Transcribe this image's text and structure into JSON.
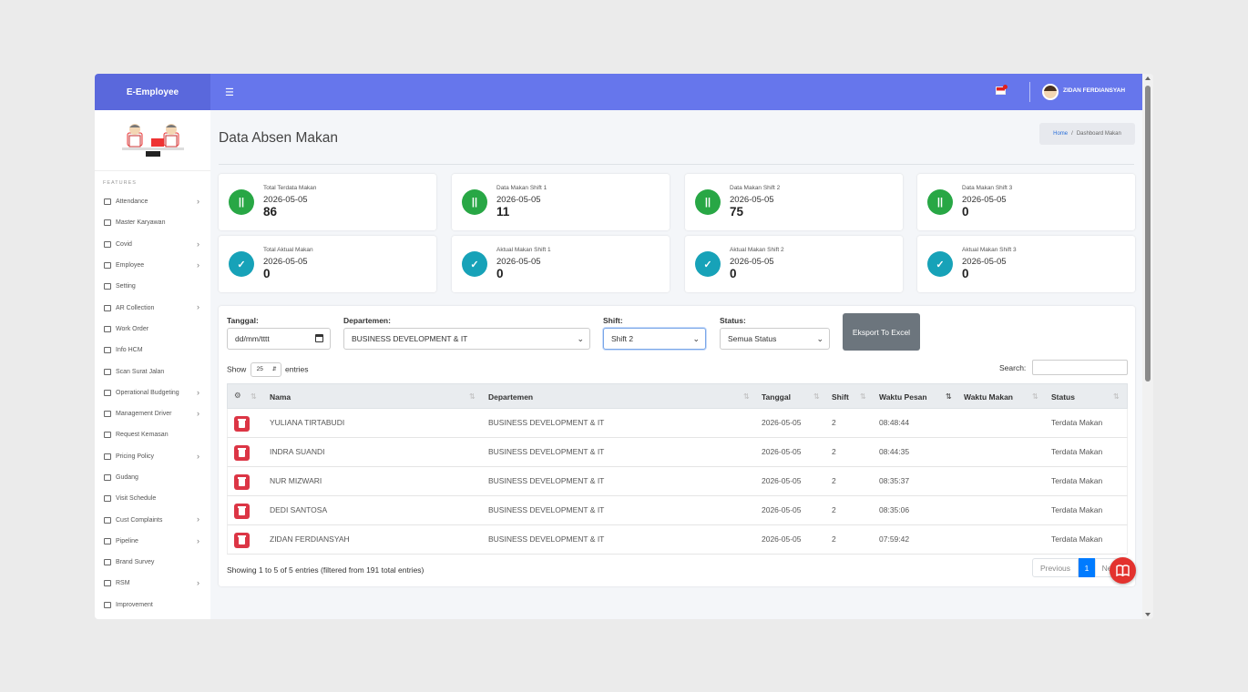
{
  "app": {
    "brand": "E-Employee",
    "user": "ZIDAN FERDIANSYAH"
  },
  "header": {
    "menu_icon": "menu-icon",
    "flag_icon": "flag-icon"
  },
  "sidebar": {
    "section": "FEATURES",
    "items": [
      {
        "label": "Attendance",
        "icon": "calendar-icon",
        "has_submenu": true
      },
      {
        "label": "Master Karyawan",
        "icon": "users-icon",
        "has_submenu": false
      },
      {
        "label": "Covid",
        "icon": "calendar-icon",
        "has_submenu": true
      },
      {
        "label": "Employee",
        "icon": "calendar-icon",
        "has_submenu": true
      },
      {
        "label": "Setting",
        "icon": "cogs-icon",
        "has_submenu": false
      },
      {
        "label": "AR Collection",
        "icon": "calendar-icon",
        "has_submenu": true
      },
      {
        "label": "Work Order",
        "icon": "clock-icon",
        "has_submenu": false
      },
      {
        "label": "Info HCM",
        "icon": "info-icon",
        "has_submenu": false
      },
      {
        "label": "Scan Surat Jalan",
        "icon": "folder-icon",
        "has_submenu": false
      },
      {
        "label": "Operational Budgeting",
        "icon": "calendar-icon",
        "has_submenu": true
      },
      {
        "label": "Management Driver",
        "icon": "calendar-icon",
        "has_submenu": true
      },
      {
        "label": "Request Kemasan",
        "icon": "send-icon",
        "has_submenu": false
      },
      {
        "label": "Pricing Policy",
        "icon": "calendar-icon",
        "has_submenu": true
      },
      {
        "label": "Gudang",
        "icon": "cogs-icon",
        "has_submenu": false
      },
      {
        "label": "Visit Schedule",
        "icon": "clock-icon",
        "has_submenu": false
      },
      {
        "label": "Cust Complaints",
        "icon": "folder-open-icon",
        "has_submenu": true
      },
      {
        "label": "Pipeline",
        "icon": "calendar-icon",
        "has_submenu": true
      },
      {
        "label": "Brand Survey",
        "icon": "comments-icon",
        "has_submenu": false
      },
      {
        "label": "RSM",
        "icon": "send-icon",
        "has_submenu": true
      },
      {
        "label": "Improvement",
        "icon": "cogs-icon",
        "has_submenu": false
      }
    ]
  },
  "page": {
    "title": "Data Absen Makan",
    "breadcrumb": {
      "home": "Home",
      "separator": "/",
      "current": "Dashboard Makan"
    }
  },
  "cards": [
    {
      "label": "Total Terdata Makan",
      "date": "2026-05-05",
      "value": "86",
      "icon": "utensils-icon",
      "color": "#28a745"
    },
    {
      "label": "Data Makan Shift 1",
      "date": "2026-05-05",
      "value": "11",
      "icon": "utensils-icon",
      "color": "#28a745"
    },
    {
      "label": "Data Makan Shift 2",
      "date": "2026-05-05",
      "value": "75",
      "icon": "utensils-icon",
      "color": "#28a745"
    },
    {
      "label": "Data Makan Shift 3",
      "date": "2026-05-05",
      "value": "0",
      "icon": "utensils-icon",
      "color": "#28a745"
    },
    {
      "label": "Total Aktual Makan",
      "date": "2026-05-05",
      "value": "0",
      "icon": "check-circle-icon",
      "color": "#17a2b8"
    },
    {
      "label": "Aktual Makan Shift 1",
      "date": "2026-05-05",
      "value": "0",
      "icon": "check-circle-icon",
      "color": "#17a2b8"
    },
    {
      "label": "Aktual Makan Shift 2",
      "date": "2026-05-05",
      "value": "0",
      "icon": "check-circle-icon",
      "color": "#17a2b8"
    },
    {
      "label": "Aktual Makan Shift 3",
      "date": "2026-05-05",
      "value": "0",
      "icon": "check-circle-icon",
      "color": "#17a2b8"
    }
  ],
  "filters": {
    "tanggal_label": "Tanggal:",
    "tanggal_placeholder": "dd/mm/tttt",
    "departemen_label": "Departemen:",
    "departemen_value": "BUSINESS DEVELOPMENT & IT",
    "shift_label": "Shift:",
    "shift_value": "Shift 2",
    "status_label": "Status:",
    "status_value": "Semua Status",
    "export_label": "Eksport To Excel"
  },
  "table_controls": {
    "show_label": "Show",
    "page_size": "25",
    "entries_label": "entries",
    "search_label": "Search:"
  },
  "table": {
    "columns": [
      "Nama",
      "Departemen",
      "Tanggal",
      "Shift",
      "Waktu Pesan",
      "Waktu Makan",
      "Status"
    ],
    "rows": [
      {
        "nama": "YULIANA TIRTABUDI",
        "departemen": "BUSINESS DEVELOPMENT & IT",
        "tanggal": "2026-05-05",
        "shift": "2",
        "waktu_pesan": "08:48:44",
        "waktu_makan": "",
        "status": "Terdata Makan"
      },
      {
        "nama": "INDRA SUANDI",
        "departemen": "BUSINESS DEVELOPMENT & IT",
        "tanggal": "2026-05-05",
        "shift": "2",
        "waktu_pesan": "08:44:35",
        "waktu_makan": "",
        "status": "Terdata Makan"
      },
      {
        "nama": "NUR MIZWARI",
        "departemen": "BUSINESS DEVELOPMENT & IT",
        "tanggal": "2026-05-05",
        "shift": "2",
        "waktu_pesan": "08:35:37",
        "waktu_makan": "",
        "status": "Terdata Makan"
      },
      {
        "nama": "DEDI SANTOSA",
        "departemen": "BUSINESS DEVELOPMENT & IT",
        "tanggal": "2026-05-05",
        "shift": "2",
        "waktu_pesan": "08:35:06",
        "waktu_makan": "",
        "status": "Terdata Makan"
      },
      {
        "nama": "ZIDAN FERDIANSYAH",
        "departemen": "BUSINESS DEVELOPMENT & IT",
        "tanggal": "2026-05-05",
        "shift": "2",
        "waktu_pesan": "07:59:42",
        "waktu_makan": "",
        "status": "Terdata Makan"
      }
    ],
    "info": "Showing 1 to 5 of 5 entries (filtered from 191 total entries)"
  },
  "pagination": {
    "previous": "Previous",
    "current": "1",
    "next": "Ne"
  },
  "colors": {
    "brand": "#5a68dc",
    "topbar": "#6676ec",
    "danger": "#dc3545",
    "primary": "#007bff",
    "export": "#6c757d"
  }
}
